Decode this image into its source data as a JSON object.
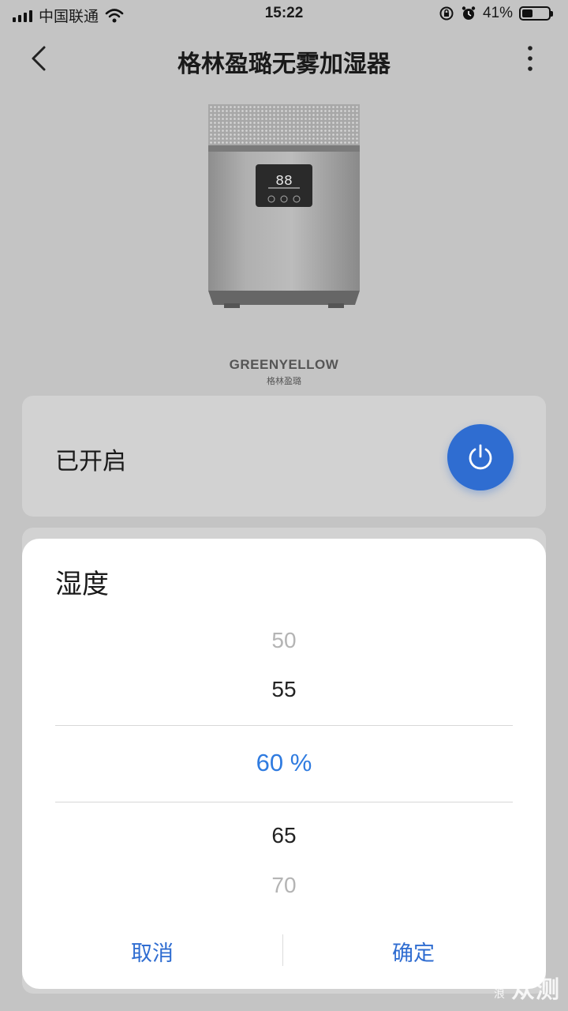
{
  "status_bar": {
    "carrier": "中国联通",
    "time": "15:22",
    "battery": "41%",
    "battery_level": 0.41
  },
  "nav": {
    "title": "格林盈璐无雾加湿器"
  },
  "product": {
    "display_digits": "88",
    "brand_en": "GREENYELLOW",
    "brand_cn": "格林盈璐"
  },
  "power_card": {
    "status": "已开启",
    "accent": "#2f6dd1"
  },
  "dialog": {
    "title": "湿度",
    "options": [
      "50",
      "55",
      "60 %",
      "65",
      "70"
    ],
    "selected_index": 2,
    "cancel_label": "取消",
    "confirm_label": "确定",
    "selected_color": "#2f7be0"
  },
  "watermark": {
    "small": "新浪",
    "large": "众测"
  }
}
